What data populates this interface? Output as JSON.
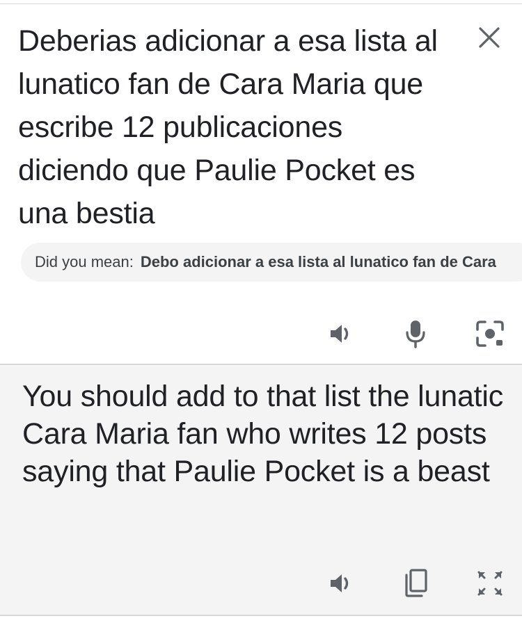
{
  "source": {
    "text": "Deberias adicionar a esa lista al lunatico fan de Cara Maria que escribe 12 publicaciones diciendo que Paulie Pocket es una bestia",
    "close_icon": "close-icon"
  },
  "suggestion": {
    "prefix": "Did you mean:",
    "corrected": "Debo adicionar a esa lista al lunatico fan de Cara"
  },
  "source_toolbar": {
    "icons": [
      "speaker-icon",
      "microphone-icon",
      "camera-lens-icon"
    ]
  },
  "result": {
    "text": "You should add to that list the lunatic Cara Maria fan who writes 12 posts saying that Paulie Pocket is a beast"
  },
  "result_toolbar": {
    "icons": [
      "speaker-icon",
      "copy-icon",
      "fullscreen-icon"
    ]
  },
  "colors": {
    "text": "#202124",
    "icon": "#5f6368",
    "panel_bg": "#f4f4f4",
    "divider": "#d7d7d7"
  }
}
